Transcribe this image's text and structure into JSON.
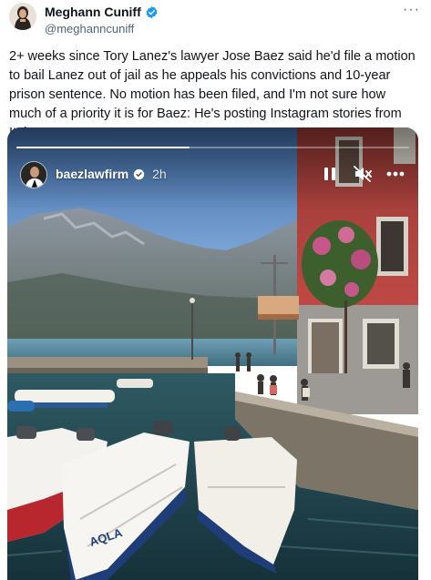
{
  "author": {
    "display_name": "Meghann Cuniff",
    "handle": "@meghanncuniff",
    "verified_icon": "verified-badge-icon",
    "avatar_icon": "user-avatar"
  },
  "menu": {
    "more_icon": "more-horizontal-icon",
    "more_label": "···"
  },
  "tweet": {
    "text": "2+ weeks since Tory Lanez's lawyer Jose Baez said he'd file a motion to bail Lanez out of jail as he appeals his convictions and 10-year prison sentence. No motion has been filed, and I'm not sure how much of a priority it is for Baez: He's posting Instagram stories from Italy."
  },
  "story": {
    "username": "baezlawfirm",
    "time_ago": "2h",
    "progress": 0.44,
    "controls": {
      "pause_icon": "pause-icon",
      "mute_icon": "speaker-muted-icon",
      "more_icon": "more-horizontal-icon"
    },
    "boat_text": "AQLA"
  },
  "colors": {
    "verified_blue": "#1d9bf0",
    "text_primary": "#0f1419",
    "text_secondary": "#536471",
    "building_red": "#c24a45"
  }
}
